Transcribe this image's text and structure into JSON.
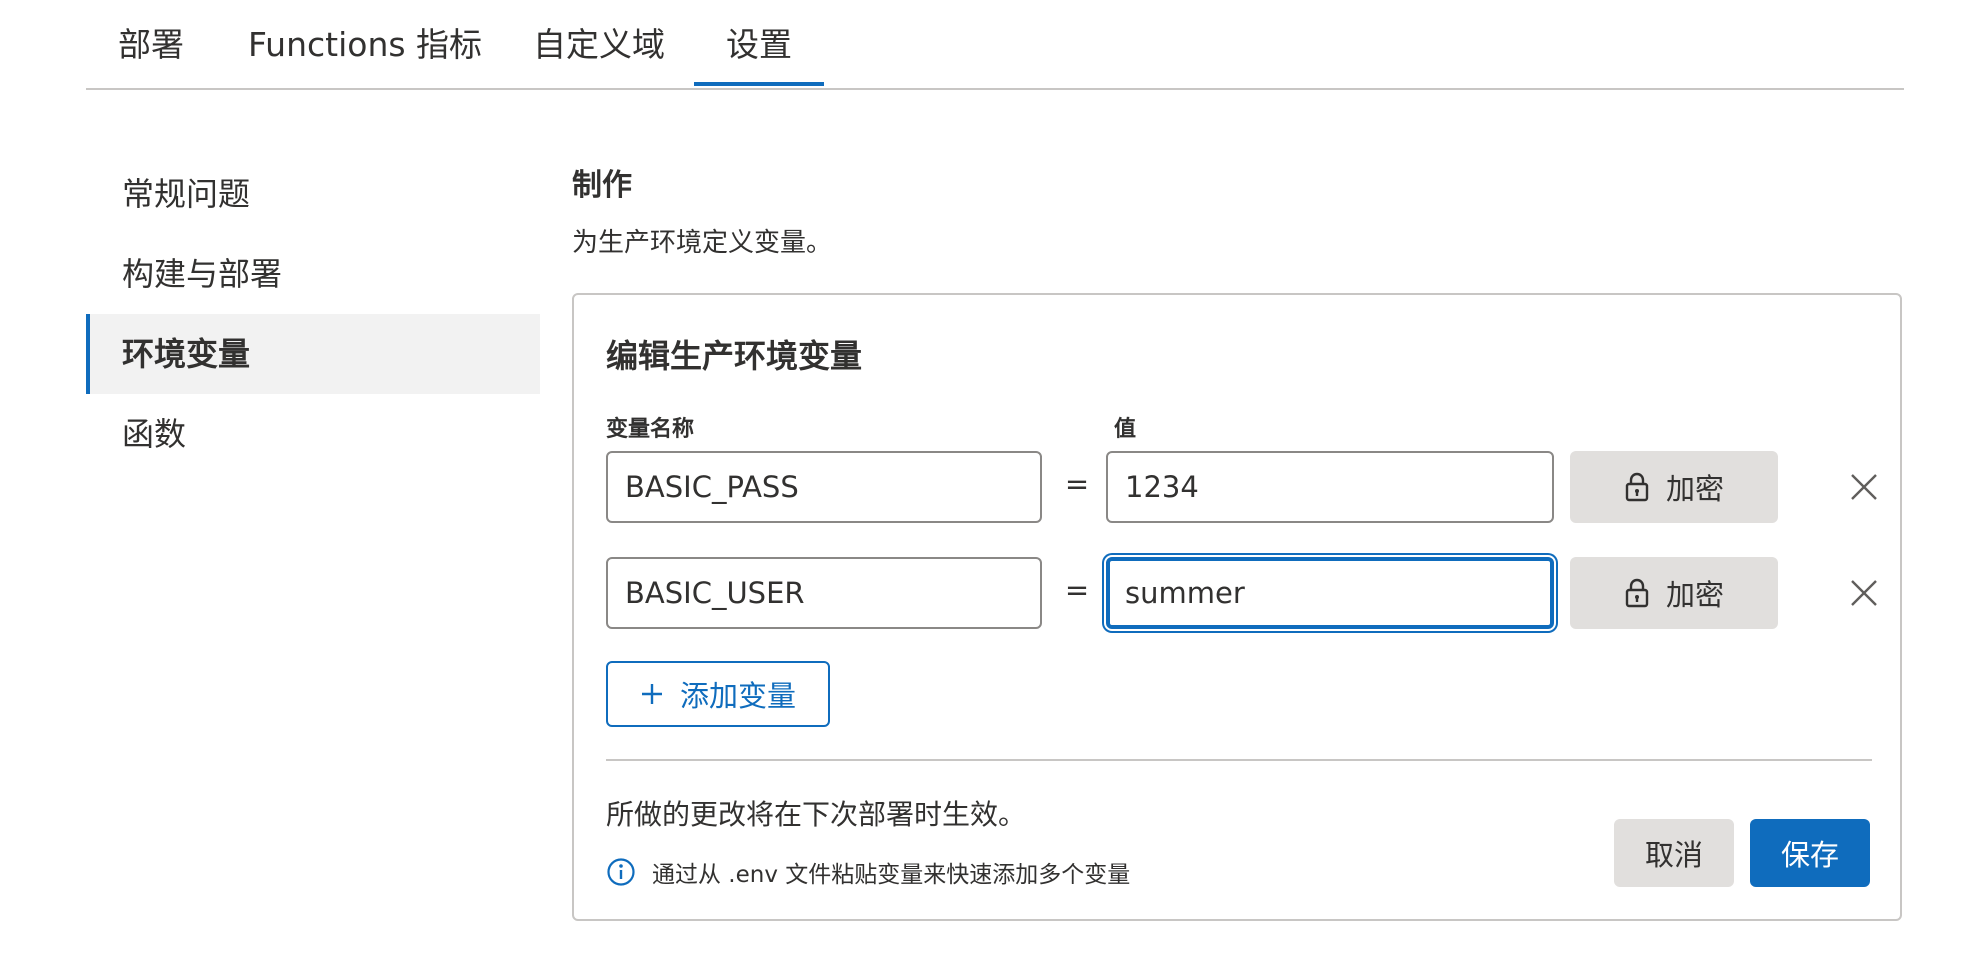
{
  "tabs": [
    {
      "label": "部署",
      "active": false
    },
    {
      "label": "Functions 指标",
      "active": false
    },
    {
      "label": "自定义域",
      "active": false
    },
    {
      "label": "设置",
      "active": true
    }
  ],
  "sidenav": {
    "items": [
      {
        "label": "常规问题",
        "active": false
      },
      {
        "label": "构建与部署",
        "active": false
      },
      {
        "label": "环境变量",
        "active": true
      },
      {
        "label": "函数",
        "active": false
      }
    ]
  },
  "section": {
    "title": "制作",
    "description": "为生产环境定义变量。"
  },
  "panel": {
    "title": "编辑生产环境变量",
    "name_column_label": "变量名称",
    "value_column_label": "值",
    "equals": "=",
    "variables": [
      {
        "name": "BASIC_PASS",
        "value": "1234",
        "encrypt_label": "加密",
        "focused": false
      },
      {
        "name": "BASIC_USER",
        "value": "summer",
        "encrypt_label": "加密",
        "focused": true
      }
    ],
    "add_button_label": "添加变量",
    "footer_note": "所做的更改将在下次部署时生效。",
    "info_text": "通过从 .env 文件粘贴变量来快速添加多个变量",
    "cancel_label": "取消",
    "save_label": "保存"
  },
  "colors": {
    "accent": "#0f6cbd",
    "neutral_button": "#e1dfdd",
    "border": "#c8c6c4"
  },
  "icons": {
    "encrypt": "lock-icon",
    "remove": "close-icon",
    "add": "plus-icon",
    "info": "info-icon"
  }
}
